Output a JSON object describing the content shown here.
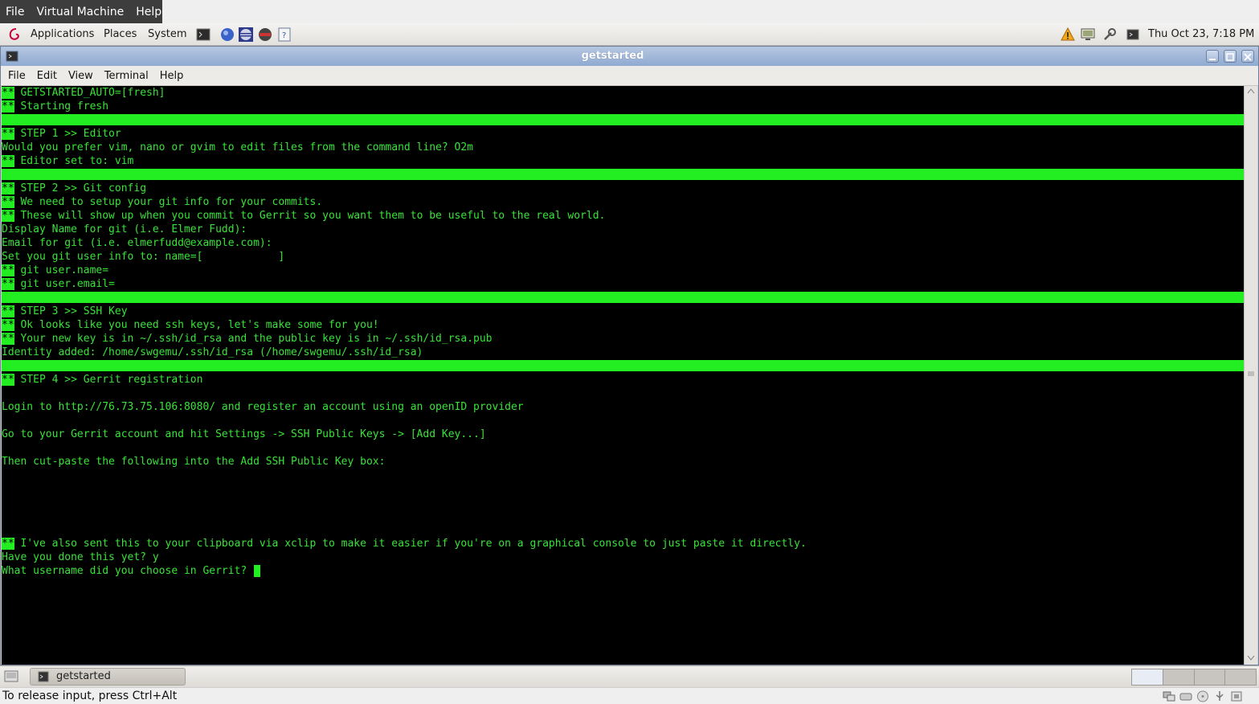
{
  "vm_menu": [
    "File",
    "Virtual Machine",
    "Help"
  ],
  "top_panel": {
    "menus": [
      "Applications",
      "Places",
      "System"
    ],
    "clock": "Thu Oct 23,  7:18 PM"
  },
  "window": {
    "title": "getstarted",
    "menu": [
      "File",
      "Edit",
      "View",
      "Terminal",
      "Help"
    ]
  },
  "terminal": {
    "lines": [
      {
        "p": "**",
        "t": " GETSTARTED_AUTO=[fresh]"
      },
      {
        "p": "**",
        "t": " Starting fresh"
      },
      {
        "bar": true
      },
      {
        "p": "**",
        "t": " STEP 1 >> Editor"
      },
      {
        "t": "Would you prefer vim, nano or gvim to edit files from the command line? O2m"
      },
      {
        "p": "**",
        "t": " Editor set to: vim"
      },
      {
        "bar": true
      },
      {
        "p": "**",
        "t": " STEP 2 >> Git config"
      },
      {
        "p": "**",
        "t": " We need to setup your git info for your commits."
      },
      {
        "p": "**",
        "t": " These will show up when you commit to Gerrit so you want them to be useful to the real world."
      },
      {
        "t": "Display Name for git (i.e. Elmer Fudd):"
      },
      {
        "t": "Email for git (i.e. elmerfudd@example.com):"
      },
      {
        "t": "Set you git user info to: name=[            ]"
      },
      {
        "p": "**",
        "t": " git user.name="
      },
      {
        "p": "**",
        "t": " git user.email="
      },
      {
        "bar": true
      },
      {
        "p": "**",
        "t": " STEP 3 >> SSH Key"
      },
      {
        "p": "**",
        "t": " Ok looks like you need ssh keys, let's make some for you!"
      },
      {
        "p": "**",
        "t": " Your new key is in ~/.ssh/id_rsa and the public key is in ~/.ssh/id_rsa.pub"
      },
      {
        "t": "Identity added: /home/swgemu/.ssh/id_rsa (/home/swgemu/.ssh/id_rsa)"
      },
      {
        "bar": true
      },
      {
        "p": "**",
        "t": " STEP 4 >> Gerrit registration"
      },
      {
        "t": ""
      },
      {
        "t": "Login to http://76.73.75.106:8080/ and register an account using an openID provider"
      },
      {
        "t": ""
      },
      {
        "t": "Go to your Gerrit account and hit Settings -> SSH Public Keys -> [Add Key...]"
      },
      {
        "t": ""
      },
      {
        "t": "Then cut-paste the following into the Add SSH Public Key box:"
      },
      {
        "t": ""
      },
      {
        "t": ""
      },
      {
        "t": ""
      },
      {
        "t": ""
      },
      {
        "t": ""
      },
      {
        "p": "**",
        "t": " I've also sent this to your clipboard via xclip to make it easier if you're on a graphical console to just paste it directly."
      },
      {
        "t": "Have you done this yet? y"
      },
      {
        "t": "What username did you choose in Gerrit? ",
        "cursor": true
      }
    ]
  },
  "taskbar": {
    "task_label": "getstarted"
  },
  "statusbar": {
    "text": "To release input, press Ctrl+Alt"
  }
}
